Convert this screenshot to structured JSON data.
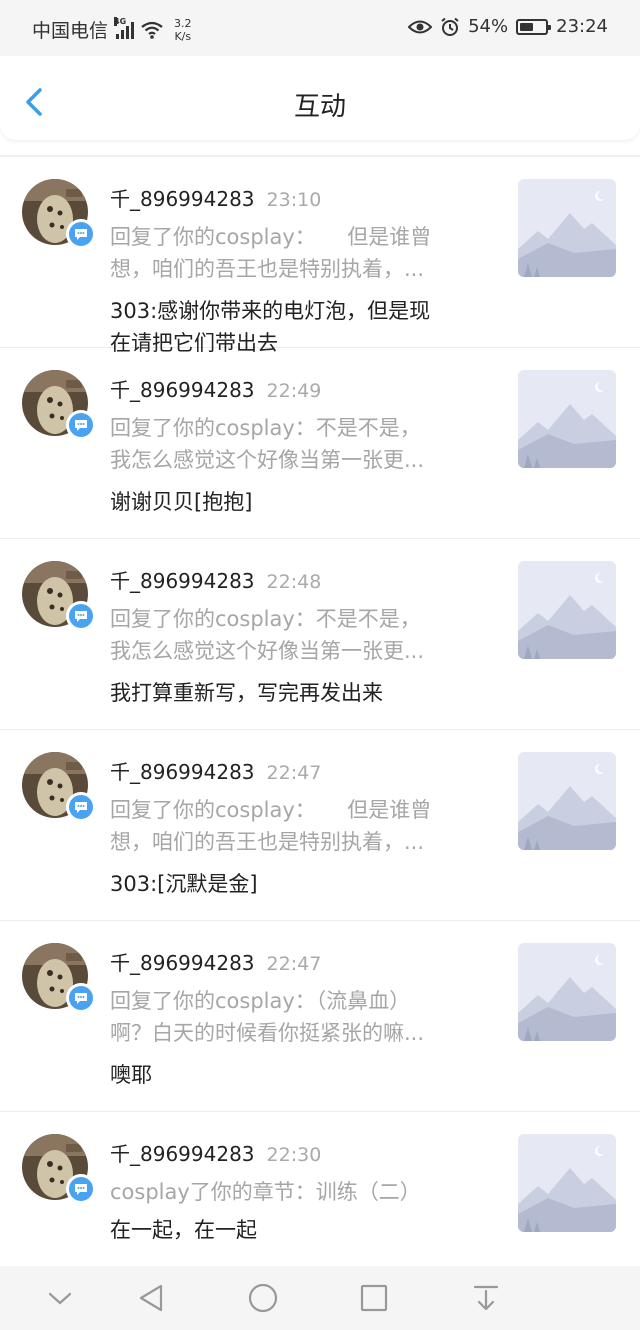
{
  "status_bar": {
    "carrier": "中国电信",
    "network": "4G",
    "speed_value": "3.2",
    "speed_unit": "K/s",
    "battery": "54%",
    "battery_level": 0.54,
    "time": "23:24"
  },
  "header": {
    "title": "互动"
  },
  "items": [
    {
      "user": "千_896994283",
      "time": "23:10",
      "quote_line1": "回复了你的cosplay：　　但是谁曾",
      "quote_line2": "想，咱们的吾王也是特别执着，...",
      "reply_line1": "303:感谢你带来的电灯泡，但是现",
      "reply_line2": "在请把它们带出去"
    },
    {
      "user": "千_896994283",
      "time": "22:49",
      "quote_line1": "回复了你的cosplay：不是不是，",
      "quote_line2": "我怎么感觉这个好像当第一张更...",
      "reply_line1": "谢谢贝贝[抱抱]",
      "reply_line2": ""
    },
    {
      "user": "千_896994283",
      "time": "22:48",
      "quote_line1": "回复了你的cosplay：不是不是，",
      "quote_line2": "我怎么感觉这个好像当第一张更...",
      "reply_line1": "我打算重新写，写完再发出来",
      "reply_line2": ""
    },
    {
      "user": "千_896994283",
      "time": "22:47",
      "quote_line1": "回复了你的cosplay：　　但是谁曾",
      "quote_line2": "想，咱们的吾王也是特别执着，...",
      "reply_line1": "303:[沉默是金]",
      "reply_line2": ""
    },
    {
      "user": "千_896994283",
      "time": "22:47",
      "quote_line1": "回复了你的cosplay：（流鼻血）",
      "quote_line2": "啊？白天的时候看你挺紧张的嘛...",
      "reply_line1": "噢耶",
      "reply_line2": ""
    },
    {
      "user": "千_896994283",
      "time": "22:30",
      "quote_line1": "cosplay了你的章节：训练（二）",
      "quote_line2": "",
      "reply_line1": "在一起，在一起",
      "reply_line2": ""
    }
  ],
  "icons": {
    "back": "chevron-left-icon",
    "comment_badge": "comment-bubble-icon",
    "nav": [
      "chevron-down-icon",
      "back-triangle-icon",
      "home-circle-icon",
      "recent-square-icon",
      "notification-pull-icon"
    ]
  },
  "colors": {
    "accent": "#4aa3f0",
    "secondary_text": "#a6a6a6",
    "primary_text": "#222222"
  }
}
